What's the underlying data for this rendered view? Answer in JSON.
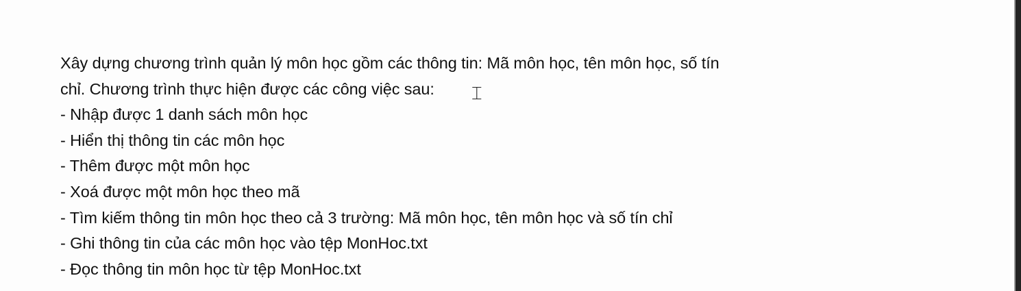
{
  "document": {
    "lines": [
      "Xây dựng chương trình quản lý môn học gồm các thông tin: Mã môn học, tên môn học, số tín",
      "chỉ. Chương trình thực hiện được các công việc sau:",
      "- Nhập được 1 danh sách môn học",
      "- Hiển thị thông tin các môn học",
      "- Thêm được một môn học",
      "- Xoá được một môn học theo mã",
      "- Tìm kiếm thông tin môn học theo cả 3 trường: Mã môn học, tên môn học và số tín chỉ",
      "- Ghi thông tin của các môn học vào tệp MonHoc.txt",
      "- Đọc thông tin môn học từ tệp MonHoc.txt"
    ]
  },
  "cursor": {
    "icon": "text-cursor-icon"
  }
}
